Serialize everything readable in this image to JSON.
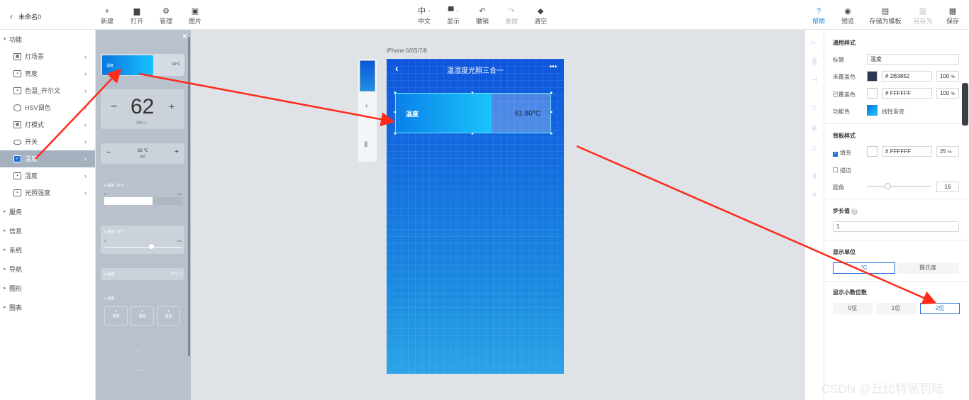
{
  "doc": {
    "title": "未命名0"
  },
  "toolbar": {
    "new": "新建",
    "open": "打开",
    "manage": "管理",
    "image": "图片",
    "lang_icon": "中 ·",
    "lang": "中文",
    "display_icon": "▀ ·",
    "display": "显示",
    "undo": "撤销",
    "redo": "重做",
    "clear": "清空",
    "help": "帮助",
    "preview": "预览",
    "save_template": "存储为模板",
    "save_as": "另存为",
    "save": "保存"
  },
  "sidebar": {
    "group_function": "功能",
    "items": [
      {
        "label": "灯场景",
        "icon": "scene-icon"
      },
      {
        "label": "亮度",
        "icon": "brightness-icon"
      },
      {
        "label": "色温_开尔文",
        "icon": "color-temp-icon"
      },
      {
        "label": "HSV调色",
        "icon": "palette-icon"
      },
      {
        "label": "灯模式",
        "icon": "lamp-mode-icon"
      },
      {
        "label": "开关",
        "icon": "toggle-icon"
      },
      {
        "label": "温度",
        "icon": "check-icon"
      },
      {
        "label": "湿度",
        "icon": "humidity-icon"
      },
      {
        "label": "光照强度",
        "icon": "light-icon"
      }
    ],
    "groups": [
      "服务",
      "信息",
      "系统",
      "导航",
      "图形",
      "图表"
    ]
  },
  "palette": {
    "gauge_label": "温度",
    "gauge_value": "62°C",
    "big_value": "62",
    "big_sub": "温度(°C)",
    "small_value": "62 ℃",
    "small_sub": "温度",
    "slider1_label": "温度",
    "slider1_value": "62°C",
    "slider1_min": "0",
    "slider1_max": "100",
    "slider2_label": "温度",
    "slider2_value": "62°C",
    "slider2_min": "0",
    "slider2_max": "100",
    "row_label": "温度",
    "row_value": "62°C >",
    "multi_label": "温度",
    "multi_items": [
      "温度",
      "温度",
      "温度"
    ],
    "small_texts": [
      "-- --",
      "---- ----"
    ]
  },
  "canvas": {
    "device": "iPhone 6/6S/7/8",
    "page_title": "温湿度光照三合一",
    "more": "•••",
    "widget_label": "温度",
    "widget_value": "61.80°C",
    "widget_fill_fraction": 0.62
  },
  "props": {
    "sec_general": "通用样式",
    "title_label": "标题",
    "title_value": "温度",
    "uncovered_label": "未覆盖色",
    "uncovered_color": "2B3852",
    "uncovered_opacity": "100",
    "covered_label": "已覆盖色",
    "covered_color": "FFFFFF",
    "covered_opacity": "100",
    "func_label": "功能色",
    "func_value": "线性渐变",
    "sec_bg": "背板样式",
    "fill_label": "填充",
    "fill_color": "FFFFFF",
    "fill_opacity": "25",
    "stroke_label": "描边",
    "radius_label": "圆角",
    "radius_value": "16",
    "sec_step": "步长值",
    "step_value": "1",
    "sec_unit": "显示单位",
    "unit_options": [
      "°C",
      "摄氏度"
    ],
    "sec_decimal": "显示小数位数",
    "decimal_options": [
      "0位",
      "1位",
      "2位"
    ],
    "pct": "%",
    "hash": "#"
  },
  "colors": {
    "uncovered": "#2B3852",
    "covered": "#FFFFFF",
    "accent": "#1e6fd6",
    "arrow": "#ff2a1a"
  },
  "watermark": "CSDN @丘比特惩罚陆"
}
